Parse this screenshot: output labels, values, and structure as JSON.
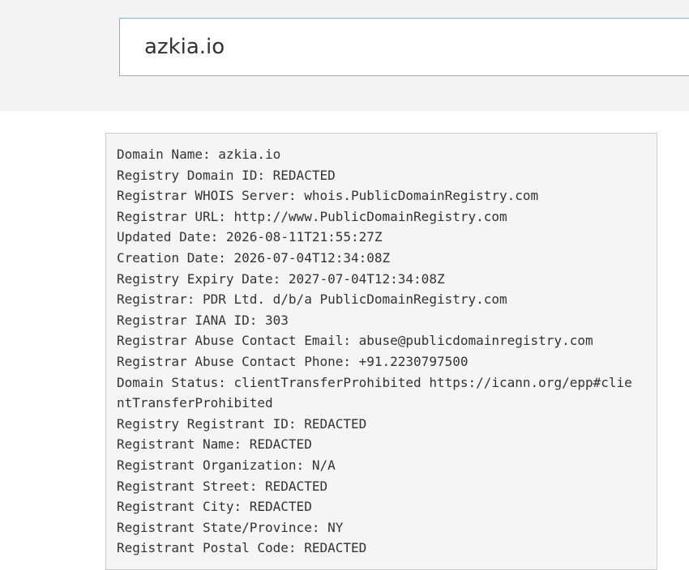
{
  "search": {
    "value": "azkia.io"
  },
  "whois": {
    "lines": [
      "Domain Name: azkia.io",
      "Registry Domain ID: REDACTED",
      "Registrar WHOIS Server: whois.PublicDomainRegistry.com",
      "Registrar URL: http://www.PublicDomainRegistry.com",
      "Updated Date: 2026-08-11T21:55:27Z",
      "Creation Date: 2026-07-04T12:34:08Z",
      "Registry Expiry Date: 2027-07-04T12:34:08Z",
      "Registrar: PDR Ltd. d/b/a PublicDomainRegistry.com",
      "Registrar IANA ID: 303",
      "Registrar Abuse Contact Email: abuse@publicdomainregistry.com",
      "Registrar Abuse Contact Phone: +91.2230797500",
      "Domain Status: clientTransferProhibited https://icann.org/epp#clie",
      "ntTransferProhibited",
      "Registry Registrant ID: REDACTED",
      "Registrant Name: REDACTED",
      "Registrant Organization: N/A",
      "Registrant Street: REDACTED",
      "Registrant City: REDACTED",
      "Registrant State/Province: NY",
      "Registrant Postal Code: REDACTED"
    ]
  }
}
